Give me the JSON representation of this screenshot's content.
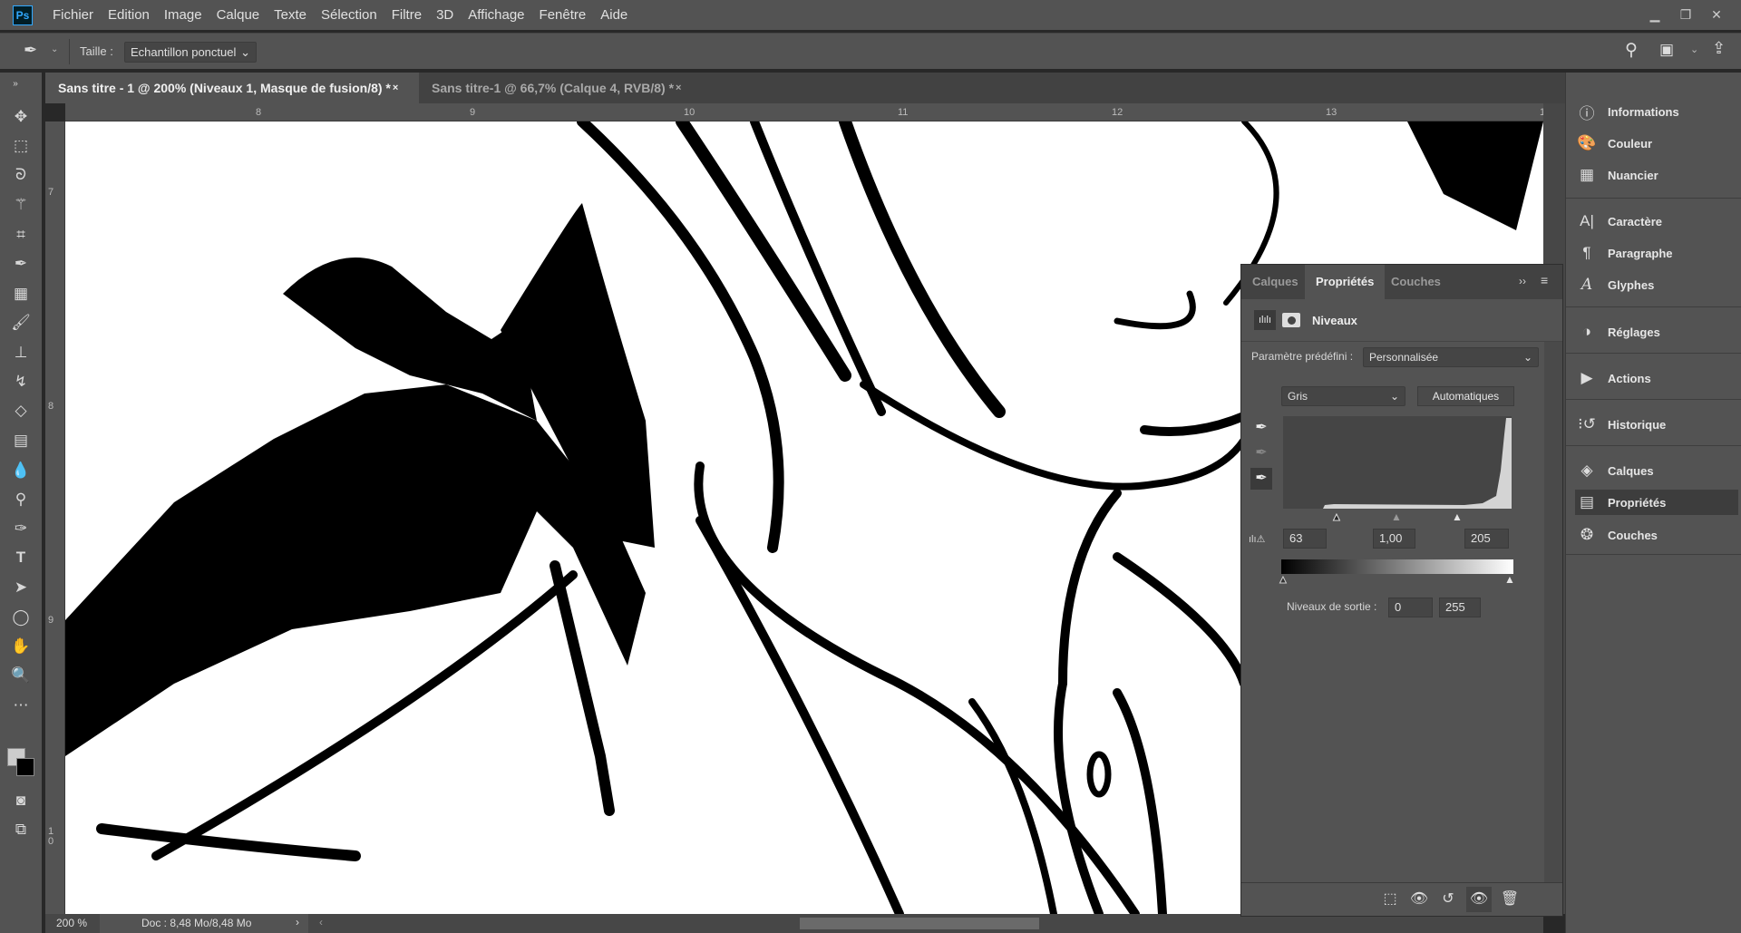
{
  "app": {
    "logo": "Ps"
  },
  "menu": [
    "Fichier",
    "Edition",
    "Image",
    "Calque",
    "Texte",
    "Sélection",
    "Filtre",
    "3D",
    "Affichage",
    "Fenêtre",
    "Aide"
  ],
  "window_controls": [
    "minimize-icon",
    "restore-icon",
    "close-icon"
  ],
  "options": {
    "size_label": "Taille :",
    "size_value": "Echantillon ponctuel"
  },
  "tabs": [
    {
      "label": "Sans titre - 1 @ 200% (Niveaux 1, Masque de fusion/8) *",
      "active": true
    },
    {
      "label": "Sans titre-1 @ 66,7% (Calque 4, RVB/8) *",
      "active": false
    }
  ],
  "ruler": {
    "h": [
      "8",
      "9",
      "10",
      "11",
      "12",
      "13",
      "1"
    ],
    "v": [
      "7",
      "8",
      "9",
      "1\n0"
    ]
  },
  "status": {
    "zoom": "200 %",
    "doc": "Doc : 8,48 Mo/8,48 Mo"
  },
  "dock": [
    {
      "label": "Informations",
      "icon": "info-icon"
    },
    {
      "label": "Couleur",
      "icon": "palette-icon"
    },
    {
      "label": "Nuancier",
      "icon": "grid-icon"
    },
    {
      "label": "Caractère",
      "icon": "character-icon"
    },
    {
      "label": "Paragraphe",
      "icon": "pilcrow-icon"
    },
    {
      "label": "Glyphes",
      "icon": "glyph-icon"
    },
    {
      "label": "Réglages",
      "icon": "adjustments-icon"
    },
    {
      "label": "Actions",
      "icon": "play-icon"
    },
    {
      "label": "Historique",
      "icon": "history-icon"
    },
    {
      "label": "Calques",
      "icon": "layers-icon"
    },
    {
      "label": "Propriétés",
      "icon": "properties-icon",
      "active": true
    },
    {
      "label": "Couches",
      "icon": "channels-icon"
    }
  ],
  "properties": {
    "tabs": [
      "Calques",
      "Propriétés",
      "Couches"
    ],
    "active_tab": "Propriétés",
    "title": "Niveaux",
    "preset_label": "Paramètre prédéfini :",
    "preset_value": "Personnalisée",
    "channel": "Gris",
    "auto_label": "Automatiques",
    "input_black": "63",
    "input_gamma": "1,00",
    "input_white": "205",
    "output_label": "Niveaux de sortie :",
    "output_black": "0",
    "output_white": "255"
  },
  "colors": {
    "accent": "#31a8ff",
    "panel": "#535353",
    "dark": "#424242"
  }
}
